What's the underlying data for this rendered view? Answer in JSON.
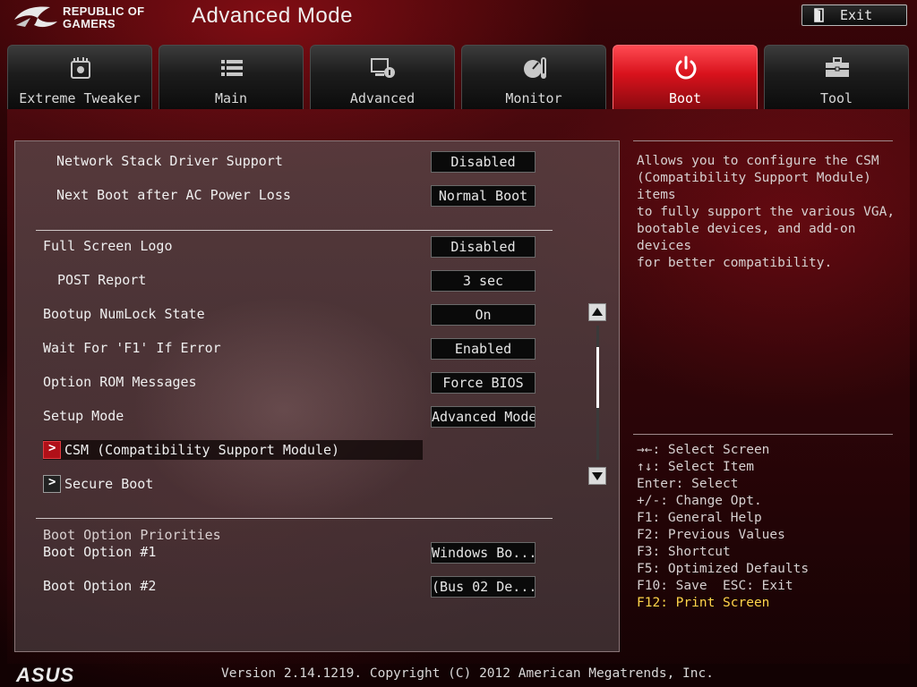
{
  "header": {
    "brand_line1": "REPUBLIC OF",
    "brand_line2": "GAMERS",
    "title": "Advanced Mode",
    "exit_label": "Exit"
  },
  "tabs": [
    {
      "label": "Extreme Tweaker",
      "icon": "extreme-tweaker-icon",
      "active": false
    },
    {
      "label": "Main",
      "icon": "list-icon",
      "active": false
    },
    {
      "label": "Advanced",
      "icon": "advanced-icon",
      "active": false
    },
    {
      "label": "Monitor",
      "icon": "monitor-gauge-icon",
      "active": false
    },
    {
      "label": "Boot",
      "icon": "power-icon",
      "active": true
    },
    {
      "label": "Tool",
      "icon": "toolbox-icon",
      "active": false
    }
  ],
  "settings": {
    "network_stack": {
      "label": "Network Stack Driver Support",
      "value": "Disabled"
    },
    "next_boot_ac": {
      "label": "Next Boot after AC Power Loss",
      "value": "Normal Boot"
    },
    "full_screen_logo": {
      "label": "Full Screen Logo",
      "value": "Disabled"
    },
    "post_report": {
      "label": "POST Report",
      "value": "3 sec"
    },
    "numlock": {
      "label": "Bootup NumLock State",
      "value": "On"
    },
    "wait_f1": {
      "label": "Wait For 'F1' If Error",
      "value": "Enabled"
    },
    "option_rom": {
      "label": "Option ROM Messages",
      "value": "Force BIOS"
    },
    "setup_mode": {
      "label": "Setup Mode",
      "value": "Advanced Mode"
    },
    "csm": {
      "label": "CSM (Compatibility Support Module)",
      "selected": true
    },
    "secure_boot": {
      "label": "Secure Boot"
    },
    "boot_priorities_heading": "Boot Option Priorities",
    "boot_option_1": {
      "label": "Boot Option #1",
      "value": "Windows Bo..."
    },
    "boot_option_2": {
      "label": "Boot Option #2",
      "value": "(Bus 02 De..."
    }
  },
  "help": {
    "description": "Allows you to configure the CSM\n(Compatibility Support Module) items\nto fully support the various VGA,\nbootable devices, and add-on devices\nfor better compatibility.",
    "keys": [
      "→←: Select Screen",
      "↑↓: Select Item",
      "Enter: Select",
      "+/-: Change Opt.",
      "F1: General Help",
      "F2: Previous Values",
      "F3: Shortcut",
      "F5: Optimized Defaults",
      "F10: Save  ESC: Exit",
      "F12: Print Screen"
    ]
  },
  "footer": {
    "brand": "ASUS",
    "version": "Version 2.14.1219. Copyright (C) 2012 American Megatrends, Inc."
  },
  "colors": {
    "accent_red": "#d8121c",
    "key_highlight": "#ffd54a",
    "background": "#120203"
  }
}
